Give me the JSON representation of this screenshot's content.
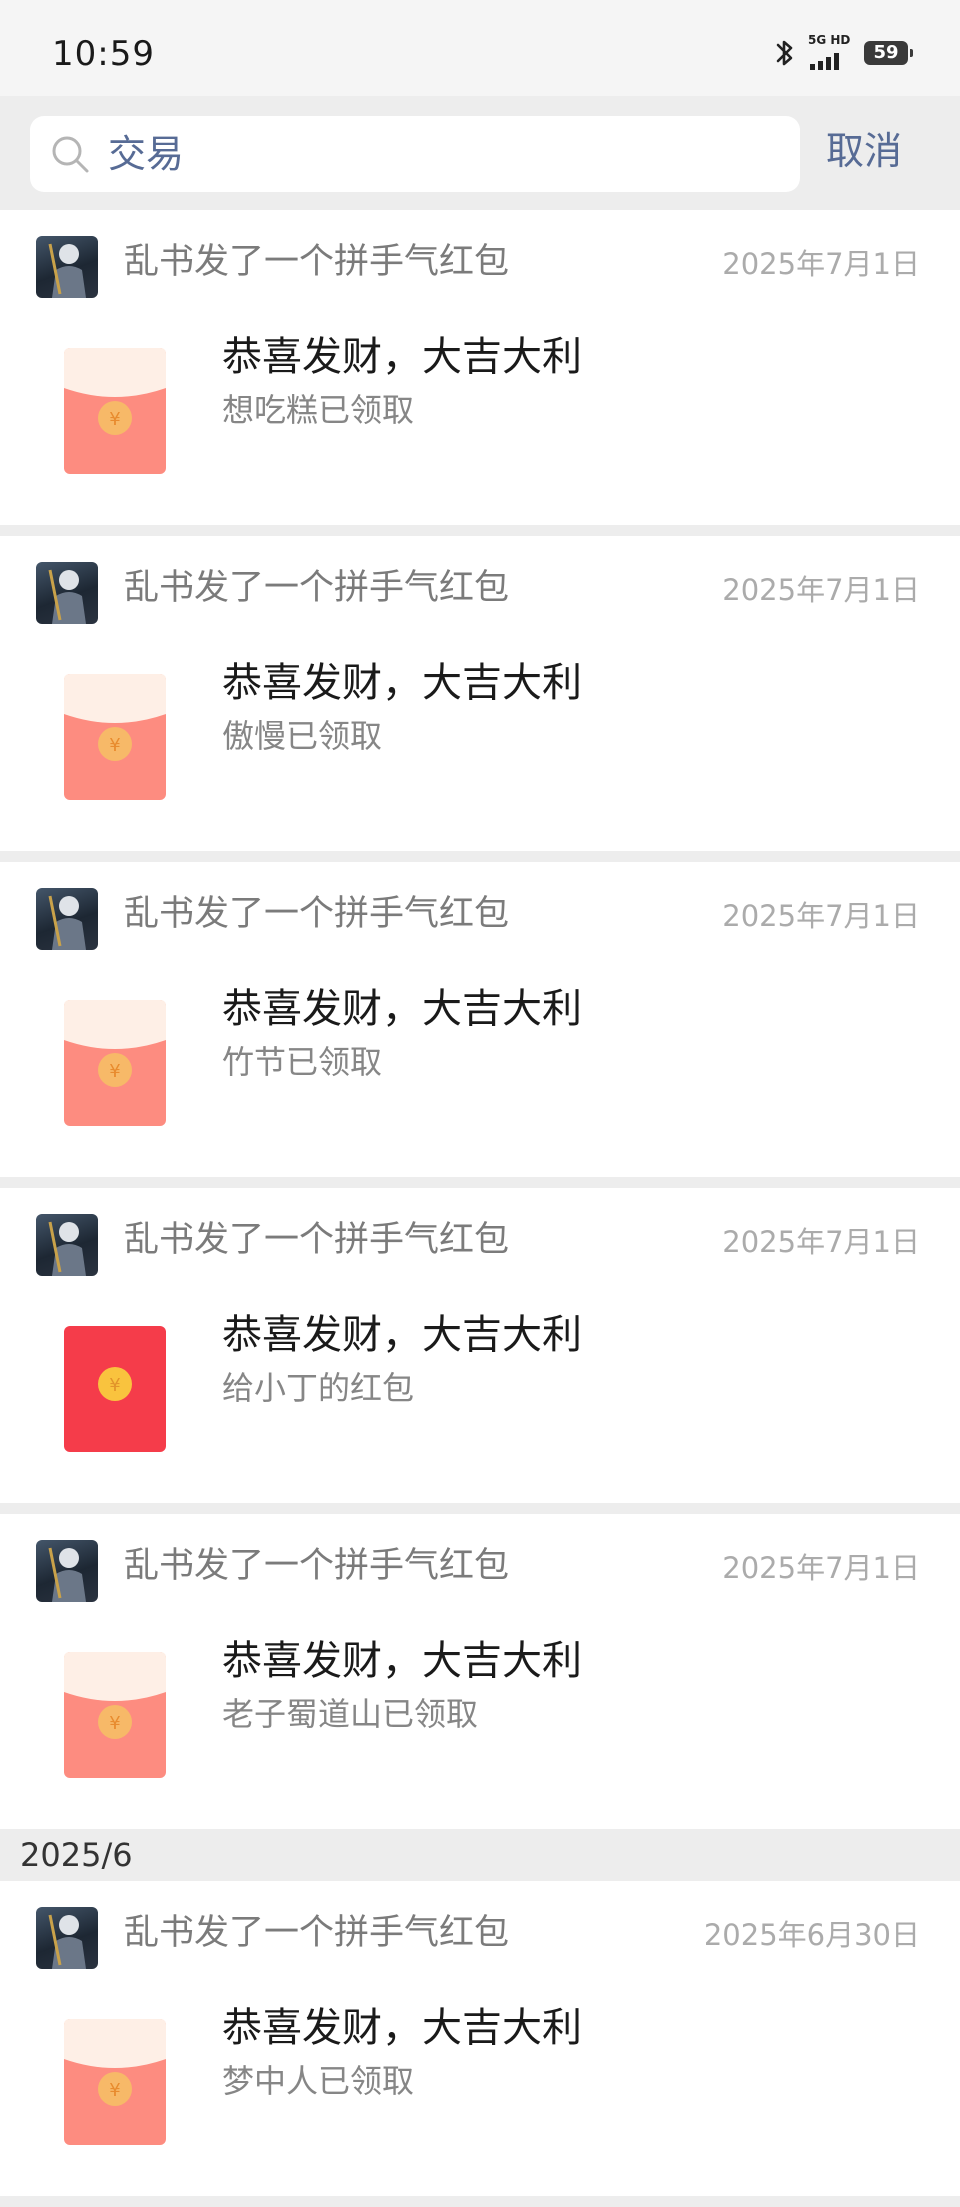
{
  "status": {
    "time": "10:59",
    "network": "5G HD",
    "battery": "59"
  },
  "search": {
    "query": "交易",
    "cancel_label": "取消"
  },
  "colors": {
    "link": "#576b95",
    "envelope_unopened": "#f53c4a",
    "envelope_opened": "#fd8c80"
  },
  "items": [
    {
      "sender": "乱书发了一个拼手气红包",
      "date": "2025年7月1日",
      "title": "恭喜发财，大吉大利",
      "status": "想吃糕已领取",
      "icon": "red-packet-opened"
    },
    {
      "sender": "乱书发了一个拼手气红包",
      "date": "2025年7月1日",
      "title": "恭喜发财，大吉大利",
      "status": "傲慢已领取",
      "icon": "red-packet-opened"
    },
    {
      "sender": "乱书发了一个拼手气红包",
      "date": "2025年7月1日",
      "title": "恭喜发财，大吉大利",
      "status": "竹节已领取",
      "icon": "red-packet-opened"
    },
    {
      "sender": "乱书发了一个拼手气红包",
      "date": "2025年7月1日",
      "title": "恭喜发财，大吉大利",
      "status": "给小丁的红包",
      "icon": "red-packet-unopened"
    },
    {
      "sender": "乱书发了一个拼手气红包",
      "date": "2025年7月1日",
      "title": "恭喜发财，大吉大利",
      "status": "老子蜀道山已领取",
      "icon": "red-packet-opened"
    }
  ],
  "month_header": "2025/6",
  "items_june": [
    {
      "sender": "乱书发了一个拼手气红包",
      "date": "2025年6月30日",
      "title": "恭喜发财，大吉大利",
      "status": "梦中人已领取",
      "icon": "red-packet-opened"
    }
  ]
}
